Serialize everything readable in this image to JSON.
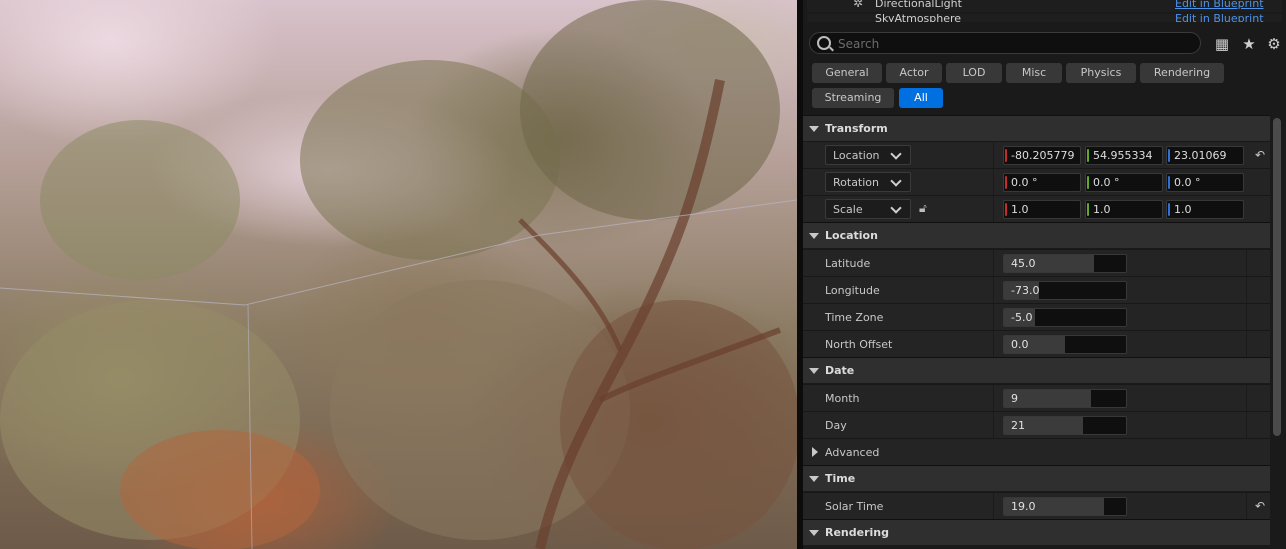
{
  "outliner": {
    "rows": [
      {
        "name": "DirectionalLight",
        "link": "Edit in Blueprint"
      },
      {
        "name": "SkyAtmosphere",
        "link": "Edit in Blueprint"
      }
    ]
  },
  "search": {
    "placeholder": "Search"
  },
  "toolbar_icons": [
    "table-view-icon",
    "star-icon",
    "gear-icon"
  ],
  "filters": [
    {
      "label": "General",
      "active": false
    },
    {
      "label": "Actor",
      "active": false
    },
    {
      "label": "LOD",
      "active": false
    },
    {
      "label": "Misc",
      "active": false
    },
    {
      "label": "Physics",
      "active": false
    },
    {
      "label": "Rendering",
      "active": false
    },
    {
      "label": "Streaming",
      "active": false
    },
    {
      "label": "All",
      "active": true
    }
  ],
  "transform": {
    "header": "Transform",
    "location": {
      "label": "Location",
      "x": "-80.205779",
      "y": "54.955334",
      "z": "23.01069"
    },
    "rotation": {
      "label": "Rotation",
      "x": "0.0 °",
      "y": "0.0 °",
      "z": "0.0 °"
    },
    "scale": {
      "label": "Scale",
      "x": "1.0",
      "y": "1.0",
      "z": "1.0"
    }
  },
  "location_section": {
    "header": "Location",
    "latitude": {
      "label": "Latitude",
      "value": "45.0",
      "fill": 0.74
    },
    "longitude": {
      "label": "Longitude",
      "value": "-73.0",
      "fill": 0.29
    },
    "time_zone": {
      "label": "Time Zone",
      "value": "-5.0",
      "fill": 0.25
    },
    "north_offset": {
      "label": "North Offset",
      "value": "0.0",
      "fill": 0.5
    }
  },
  "date_section": {
    "header": "Date",
    "month": {
      "label": "Month",
      "value": "9",
      "fill": 0.71
    },
    "day": {
      "label": "Day",
      "value": "21",
      "fill": 0.65
    },
    "advanced": {
      "label": "Advanced"
    }
  },
  "time_section": {
    "header": "Time",
    "solar_time": {
      "label": "Solar Time",
      "value": "19.0",
      "fill": 0.82
    }
  },
  "rendering_section": {
    "header": "Rendering"
  },
  "colors": {
    "accent": "#0070e0",
    "x_axis": "#c52b2b",
    "y_axis": "#66a92a",
    "z_axis": "#2f6fd6"
  }
}
